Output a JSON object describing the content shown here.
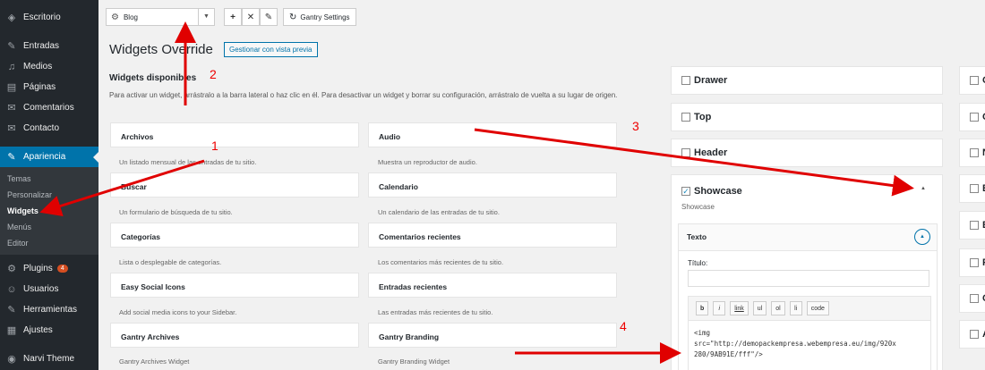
{
  "sidebar": {
    "items": [
      {
        "icon": "dashboard-icon",
        "glyph": "◈",
        "label": "Escritorio"
      },
      {
        "icon": "pin-icon",
        "glyph": "✎",
        "label": "Entradas"
      },
      {
        "icon": "media-icon",
        "glyph": "♫",
        "label": "Medios"
      },
      {
        "icon": "page-icon",
        "glyph": "▤",
        "label": "Páginas"
      },
      {
        "icon": "comment-icon",
        "glyph": "✉",
        "label": "Comentarios"
      },
      {
        "icon": "contact-icon",
        "glyph": "✉",
        "label": "Contacto"
      },
      {
        "icon": "brush-icon",
        "glyph": "✎",
        "label": "Apariencia"
      }
    ],
    "submenu": [
      "Temas",
      "Personalizar",
      "Widgets",
      "Menús",
      "Editor"
    ],
    "items2": [
      {
        "icon": "plugin-icon",
        "glyph": "⚙",
        "label": "Plugins",
        "badge": "4"
      },
      {
        "icon": "users-icon",
        "glyph": "☺",
        "label": "Usuarios"
      },
      {
        "icon": "tools-icon",
        "glyph": "✎",
        "label": "Herramientas"
      },
      {
        "icon": "settings-icon",
        "glyph": "▦",
        "label": "Ajustes"
      }
    ],
    "theme": {
      "icon": "theme-icon",
      "glyph": "◉",
      "label": "Narvi Theme"
    }
  },
  "toolbar": {
    "select_value": "Blog",
    "add": "+",
    "remove": "✕",
    "edit": "✎",
    "gantry_settings": "Gantry Settings"
  },
  "page": {
    "title": "Widgets Override",
    "preview_button": "Gestionar con vista previa",
    "available_title": "Widgets disponibles",
    "available_desc": "Para activar un widget, arrástralo a la barra lateral o haz clic en él. Para desactivar un widget y borrar su configuración, arrástralo de vuelta a su lugar de origen."
  },
  "widgets": [
    {
      "name": "Archivos",
      "desc": "Un listado mensual de las entradas de tu sitio."
    },
    {
      "name": "Audio",
      "desc": "Muestra un reproductor de audio."
    },
    {
      "name": "Buscar",
      "desc": "Un formulario de búsqueda de tu sitio."
    },
    {
      "name": "Calendario",
      "desc": "Un calendario de las entradas de tu sitio."
    },
    {
      "name": "Categorías",
      "desc": "Lista o desplegable de categorías."
    },
    {
      "name": "Comentarios recientes",
      "desc": "Los comentarios más recientes de tu sitio."
    },
    {
      "name": "Easy Social Icons",
      "desc": "Add social media icons to your Sidebar."
    },
    {
      "name": "Entradas recientes",
      "desc": "Las entradas más recientes de tu sitio."
    },
    {
      "name": "Gantry Archives",
      "desc": "Gantry Archives Widget"
    },
    {
      "name": "Gantry Branding",
      "desc": "Gantry Branding Widget"
    }
  ],
  "areas": [
    {
      "name": "Drawer",
      "checked": false
    },
    {
      "name": "Top",
      "checked": false
    },
    {
      "name": "Header",
      "checked": false
    }
  ],
  "showcase": {
    "name": "Showcase",
    "subtitle": "Showcase",
    "widget_title": "Texto",
    "field_label": "Título:",
    "quicktags": [
      "b",
      "i",
      "link",
      "ul",
      "ol",
      "li",
      "code"
    ],
    "content": "<img\nsrc=\"http://demopackempresa.webempresa.eu/img/920x\n280/9AB91E/fff\"/>"
  },
  "far_column": [
    "G",
    "C",
    "N",
    "B",
    "E",
    "F",
    "C",
    "A"
  ],
  "annotations": [
    "1",
    "2",
    "3",
    "4"
  ],
  "colors": {
    "sidebar_bg": "#23282d",
    "accent": "#0073aa",
    "arrow": "#e00000"
  }
}
